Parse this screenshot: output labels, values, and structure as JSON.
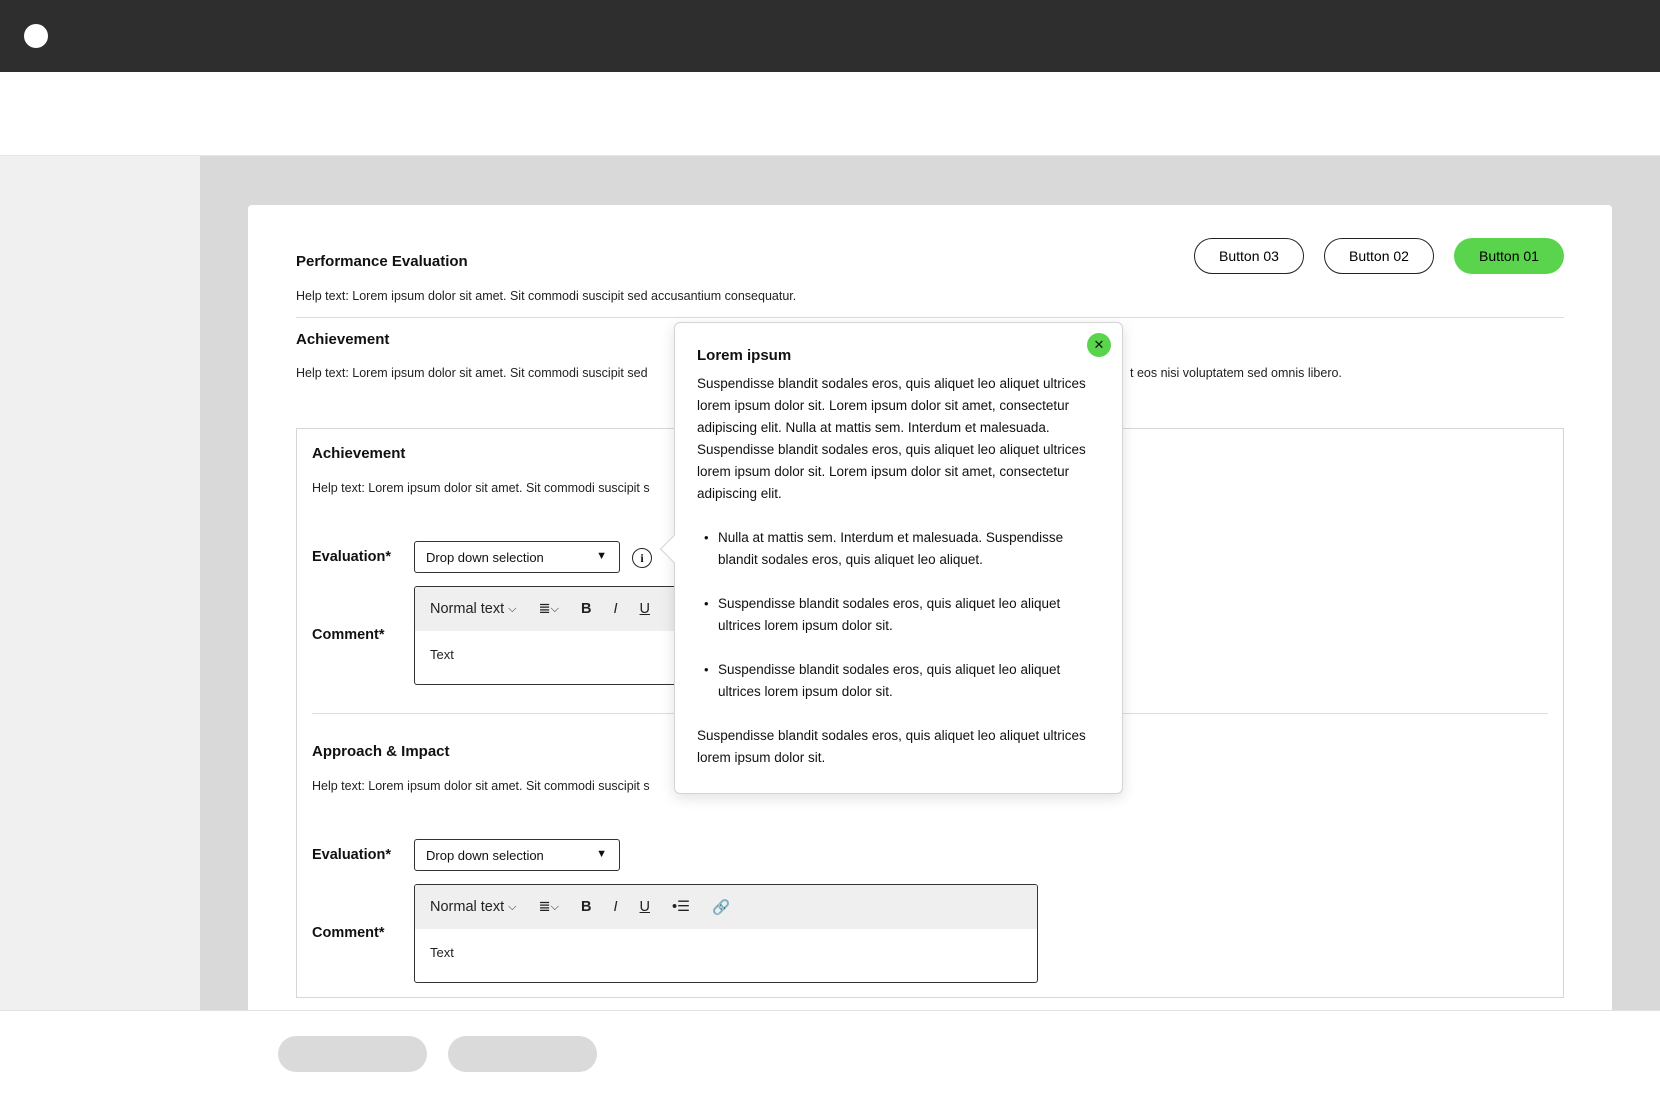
{
  "card": {
    "title": "Performance Evaluation",
    "help": "Help text: Lorem ipsum dolor sit amet. Sit commodi suscipit sed accusantium consequatur.",
    "buttons": {
      "button3": "Button 03",
      "button2": "Button 02",
      "button1": "Button 01"
    }
  },
  "achievement": {
    "title": "Achievement",
    "help_left": "Help text: Lorem ipsum dolor sit amet. Sit commodi suscipit sed",
    "help_right": "t eos nisi voluptatem sed omnis libero."
  },
  "sections": [
    {
      "title": "Achievement",
      "help": "Help text: Lorem ipsum dolor sit amet. Sit commodi suscipit s",
      "evaluation_label": "Evaluation*",
      "dropdown": "Drop down selection",
      "comment_label": "Comment*",
      "toolbar_style": "Normal text",
      "editor_text": "Text"
    },
    {
      "title": "Approach & Impact",
      "help": "Help text: Lorem ipsum dolor sit amet. Sit commodi suscipit s",
      "evaluation_label": "Evaluation*",
      "dropdown": "Drop down selection",
      "comment_label": "Comment*",
      "toolbar_style": "Normal text",
      "editor_text": "Text"
    }
  ],
  "popover": {
    "title": "Lorem ipsum",
    "intro": "Suspendisse blandit sodales eros, quis aliquet leo aliquet ultrices lorem ipsum dolor sit. Lorem ipsum dolor sit amet, consectetur adipiscing elit. Nulla at mattis sem. Interdum et malesuada. Suspendisse blandit sodales eros, quis aliquet leo aliquet ultrices lorem ipsum dolor sit. Lorem ipsum dolor sit amet, consectetur adipiscing elit.",
    "bullets": [
      "Nulla at mattis sem. Interdum et malesuada. Suspendisse blandit sodales eros, quis aliquet leo aliquet.",
      "Suspendisse blandit sodales eros, quis aliquet leo aliquet ultrices lorem ipsum dolor sit.",
      "Suspendisse blandit sodales eros, quis aliquet leo aliquet ultrices lorem ipsum dolor sit."
    ],
    "outro": "Suspendisse blandit sodales eros, quis aliquet leo aliquet ultrices lorem ipsum dolor sit.",
    "close_icon": "close-icon"
  },
  "colors": {
    "accent": "#5ad44c",
    "topbar": "#2e2e2e",
    "background": "#d9d9d9"
  }
}
